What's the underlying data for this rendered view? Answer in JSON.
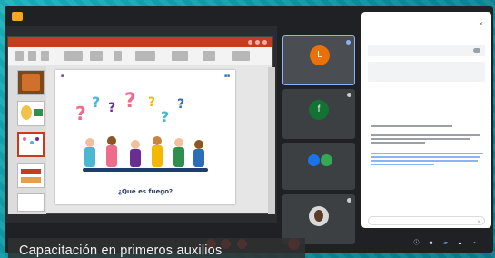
{
  "caption": "Capacitación en primeros auxilios",
  "colors": {
    "accent": "#1a73e8",
    "leave": "#d93025",
    "ppt": "#c43e1c",
    "frame": "#0c9aa8"
  },
  "icons": {
    "presenting": "presentation-icon",
    "info": "info-icon",
    "people": "people-icon",
    "chat": "chat-icon",
    "activities": "activities-icon",
    "lock": "lock-icon",
    "send": "send-icon",
    "close": "close-icon"
  },
  "slide": {
    "text": "¿Qué es fuego?"
  }
}
